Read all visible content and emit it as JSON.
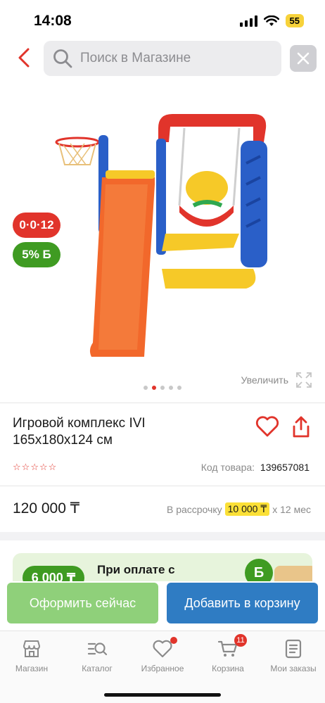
{
  "status_bar": {
    "time": "14:08",
    "battery": "55"
  },
  "search": {
    "placeholder": "Поиск в Магазине"
  },
  "gallery": {
    "badge_installment": "0·0·12",
    "badge_bonus": "5% Б",
    "zoom_label": "Увеличить",
    "dots_count": 5,
    "active_dot": 2
  },
  "product": {
    "title": "Игровой комплекс IVI 165x180x124 см",
    "rating_stars": 5,
    "rating_value": 0,
    "sku_label": "Код товара:",
    "sku_value": "139657081"
  },
  "price": {
    "value": "120 000 ₸",
    "installment_prefix": "В рассрочку",
    "installment_amount": "10 000 ₸",
    "installment_suffix": "x 12 мес"
  },
  "promo": {
    "amount": "6 000 ₸",
    "text": "При оплате с",
    "coin": "Б"
  },
  "actions": {
    "buy_now": "Оформить сейчас",
    "add_to_cart": "Добавить в корзину"
  },
  "tab_bar": {
    "items": [
      {
        "label": "Магазин",
        "icon": "store-icon"
      },
      {
        "label": "Каталог",
        "icon": "catalog-search-icon"
      },
      {
        "label": "Избранное",
        "icon": "heart-icon"
      },
      {
        "label": "Корзина",
        "icon": "cart-icon",
        "count": "11"
      },
      {
        "label": "Мои заказы",
        "icon": "orders-icon"
      }
    ]
  },
  "colors": {
    "accent_red": "#e1342b",
    "bonus_green": "#3f9b22",
    "buy_button": "#8fd07a",
    "cart_button": "#2f7cc3",
    "installment_highlight": "#fbe037"
  }
}
